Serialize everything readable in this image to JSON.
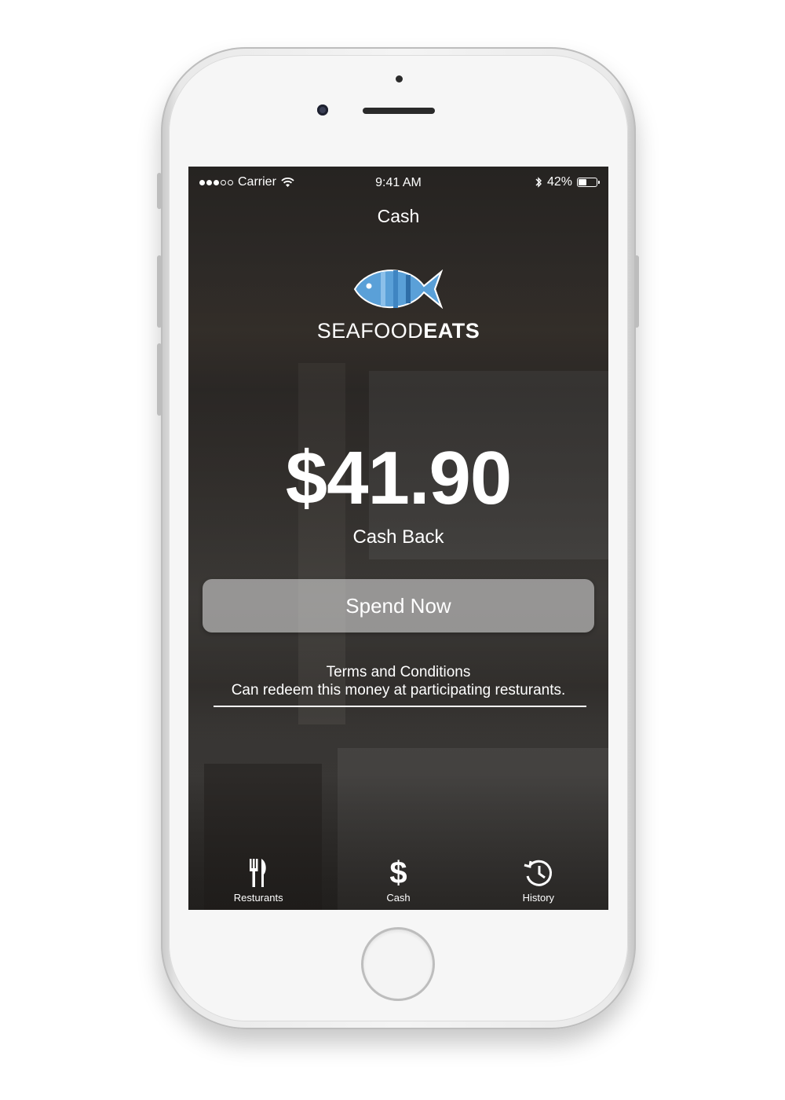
{
  "status_bar": {
    "carrier": "Carrier",
    "time": "9:41 AM",
    "battery_percent": "42%",
    "battery_level": 0.42,
    "signal_bars_filled": 3,
    "signal_bars_total": 5
  },
  "nav": {
    "title": "Cash"
  },
  "logo": {
    "brand_light": "SEAFOOD",
    "brand_bold": "EATS",
    "icon": "fish-icon",
    "color": "#5aa0d8"
  },
  "balance": {
    "amount": "$41.90",
    "label": "Cash Back"
  },
  "actions": {
    "spend_label": "Spend Now"
  },
  "terms": {
    "title": "Terms and Conditions",
    "text": "Can redeem this money at participating resturants."
  },
  "tabs": [
    {
      "label": "Resturants",
      "icon": "fork-knife-icon"
    },
    {
      "label": "Cash",
      "icon": "dollar-icon"
    },
    {
      "label": "History",
      "icon": "history-clock-icon"
    }
  ]
}
